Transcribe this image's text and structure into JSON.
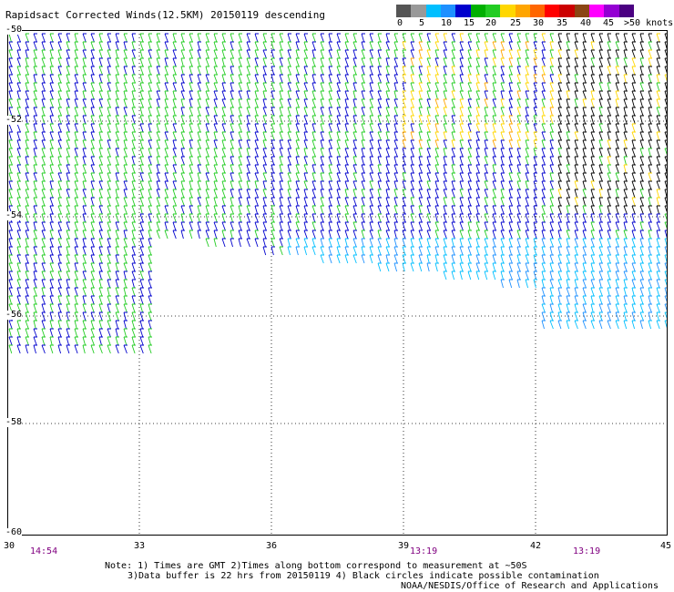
{
  "title": "Rapidsact Corrected Winds(12.5KM) 20150119 descending",
  "legend": {
    "colors": [
      "#555555",
      "#999999",
      "#00bfff",
      "#1e90ff",
      "#0000cd",
      "#00b000",
      "#22cc22",
      "#ffd700",
      "#ffa500",
      "#ff6600",
      "#ff0000",
      "#cc0000",
      "#8b4513",
      "#ff00ff",
      "#9400d3",
      "#4b0082"
    ],
    "labels": [
      "0",
      "5",
      "10",
      "15",
      "20",
      "25",
      "30",
      "35",
      "40",
      "45",
      ">50 knots"
    ]
  },
  "axes": {
    "lat_labels": [
      "-50",
      "-52",
      "-54",
      "-56",
      "-58",
      "-60"
    ],
    "lon_labels": [
      "30",
      "33",
      "36",
      "39",
      "42",
      "45"
    ]
  },
  "times": [
    "14:54",
    "13:19",
    "13:19"
  ],
  "notes": {
    "line1": "Note: 1) Times are GMT 2)Times along bottom correspond to measurement at ~50S",
    "line2": "3)Data buffer is 22 hrs from 20150119 4) Black circles indicate possible contamination",
    "line3": "NOAA/NESDIS/Office of Research and Applications"
  }
}
